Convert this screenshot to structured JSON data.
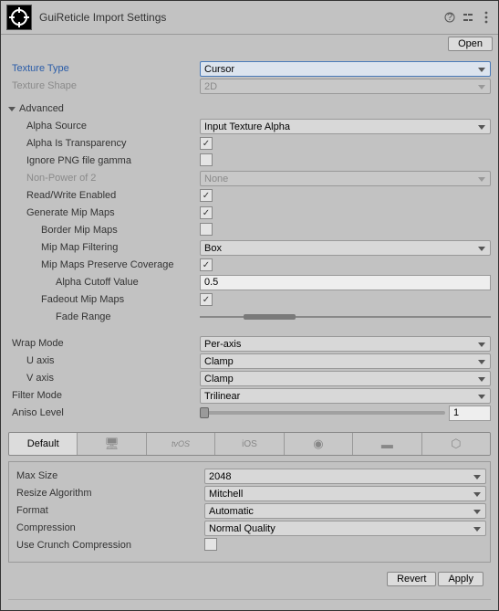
{
  "header": {
    "title": "GuiReticle Import Settings",
    "open": "Open"
  },
  "main": {
    "textureType": {
      "label": "Texture Type",
      "value": "Cursor"
    },
    "textureShape": {
      "label": "Texture Shape",
      "value": "2D"
    }
  },
  "advanced": {
    "label": "Advanced",
    "alphaSource": {
      "label": "Alpha Source",
      "value": "Input Texture Alpha"
    },
    "alphaIsTransparency": {
      "label": "Alpha Is Transparency"
    },
    "ignorePngGamma": {
      "label": "Ignore PNG file gamma"
    },
    "nonPowerOf2": {
      "label": "Non-Power of 2",
      "value": "None"
    },
    "readWrite": {
      "label": "Read/Write Enabled"
    },
    "generateMipMaps": {
      "label": "Generate Mip Maps"
    },
    "borderMipMaps": {
      "label": "Border Mip Maps"
    },
    "mipMapFiltering": {
      "label": "Mip Map Filtering",
      "value": "Box"
    },
    "mipMapsPreserveCoverage": {
      "label": "Mip Maps Preserve Coverage"
    },
    "alphaCutoffValue": {
      "label": "Alpha Cutoff Value",
      "value": "0.5"
    },
    "fadeoutMipMaps": {
      "label": "Fadeout Mip Maps"
    },
    "fadeRange": {
      "label": "Fade Range"
    }
  },
  "wrap": {
    "wrapMode": {
      "label": "Wrap Mode",
      "value": "Per-axis"
    },
    "uAxis": {
      "label": "U axis",
      "value": "Clamp"
    },
    "vAxis": {
      "label": "V axis",
      "value": "Clamp"
    },
    "filterMode": {
      "label": "Filter Mode",
      "value": "Trilinear"
    },
    "anisoLevel": {
      "label": "Aniso Level",
      "value": "1"
    }
  },
  "platform": {
    "tabs": {
      "default": "Default"
    },
    "maxSize": {
      "label": "Max Size",
      "value": "2048"
    },
    "resizeAlgorithm": {
      "label": "Resize Algorithm",
      "value": "Mitchell"
    },
    "format": {
      "label": "Format",
      "value": "Automatic"
    },
    "compression": {
      "label": "Compression",
      "value": "Normal Quality"
    },
    "useCrunch": {
      "label": "Use Crunch Compression"
    }
  },
  "footer": {
    "revert": "Revert",
    "apply": "Apply"
  }
}
